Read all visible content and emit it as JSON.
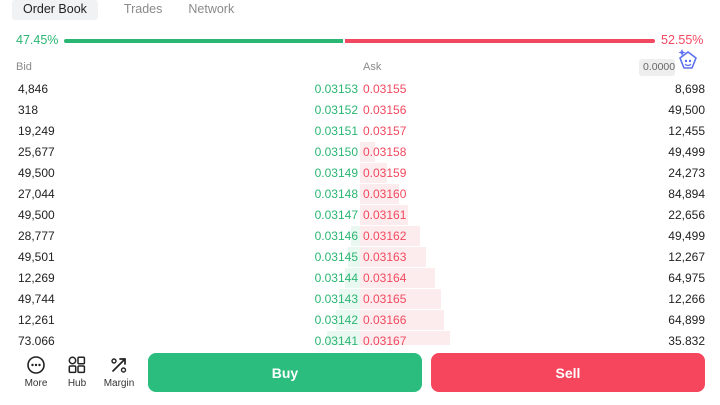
{
  "tabs": [
    {
      "label": "Order Book",
      "active": true
    },
    {
      "label": "Trades",
      "active": false
    },
    {
      "label": "Network",
      "active": false
    }
  ],
  "ratio": {
    "bid_pct": "47.45%",
    "ask_pct": "52.55%",
    "bid_fraction": 0.4745
  },
  "headers": {
    "bid": "Bid",
    "ask": "Ask",
    "precision": "0.000001"
  },
  "rows": [
    {
      "bid_qty": "4,846",
      "bid_price": "0.03153",
      "ask_price": "0.03155",
      "ask_qty": "8,698",
      "bid_depth": 0.0,
      "ask_depth": 0.0
    },
    {
      "bid_qty": "318",
      "bid_price": "0.03152",
      "ask_price": "0.03156",
      "ask_qty": "49,500",
      "bid_depth": 0.0,
      "ask_depth": 0.0
    },
    {
      "bid_qty": "19,249",
      "bid_price": "0.03151",
      "ask_price": "0.03157",
      "ask_qty": "12,455",
      "bid_depth": 0.0,
      "ask_depth": 0.0
    },
    {
      "bid_qty": "25,677",
      "bid_price": "0.03150",
      "ask_price": "0.03158",
      "ask_qty": "49,499",
      "bid_depth": 0.0,
      "ask_depth": 0.05
    },
    {
      "bid_qty": "49,500",
      "bid_price": "0.03149",
      "ask_price": "0.03159",
      "ask_qty": "24,273",
      "bid_depth": 0.0,
      "ask_depth": 0.09
    },
    {
      "bid_qty": "27,044",
      "bid_price": "0.03148",
      "ask_price": "0.03160",
      "ask_qty": "84,894",
      "bid_depth": 0.0,
      "ask_depth": 0.13
    },
    {
      "bid_qty": "49,500",
      "bid_price": "0.03147",
      "ask_price": "0.03161",
      "ask_qty": "22,656",
      "bid_depth": 0.0,
      "ask_depth": 0.16
    },
    {
      "bid_qty": "28,777",
      "bid_price": "0.03146",
      "ask_price": "0.03162",
      "ask_qty": "49,499",
      "bid_depth": 0.03,
      "ask_depth": 0.2
    },
    {
      "bid_qty": "49,501",
      "bid_price": "0.03145",
      "ask_price": "0.03163",
      "ask_qty": "12,267",
      "bid_depth": 0.04,
      "ask_depth": 0.22
    },
    {
      "bid_qty": "12,269",
      "bid_price": "0.03144",
      "ask_price": "0.03164",
      "ask_qty": "64,975",
      "bid_depth": 0.05,
      "ask_depth": 0.25
    },
    {
      "bid_qty": "49,744",
      "bid_price": "0.03143",
      "ask_price": "0.03165",
      "ask_qty": "12,266",
      "bid_depth": 0.07,
      "ask_depth": 0.27
    },
    {
      "bid_qty": "12,261",
      "bid_price": "0.03142",
      "ask_price": "0.03166",
      "ask_qty": "64,899",
      "bid_depth": 0.08,
      "ask_depth": 0.28
    },
    {
      "bid_qty": "73,066",
      "bid_price": "0.03141",
      "ask_price": "0.03167",
      "ask_qty": "35,832",
      "bid_depth": 0.11,
      "ask_depth": 0.3
    }
  ],
  "bottom_nav": [
    {
      "label": "More",
      "icon": "more-dots-icon"
    },
    {
      "label": "Hub",
      "icon": "hub-grid-icon"
    },
    {
      "label": "Margin",
      "icon": "margin-percent-icon"
    }
  ],
  "actions": {
    "buy_label": "Buy",
    "sell_label": "Sell"
  },
  "colors": {
    "bid": "#2bb673",
    "ask": "#f2485f",
    "buy_button": "#2bbd7e",
    "sell_button": "#f6465d"
  }
}
